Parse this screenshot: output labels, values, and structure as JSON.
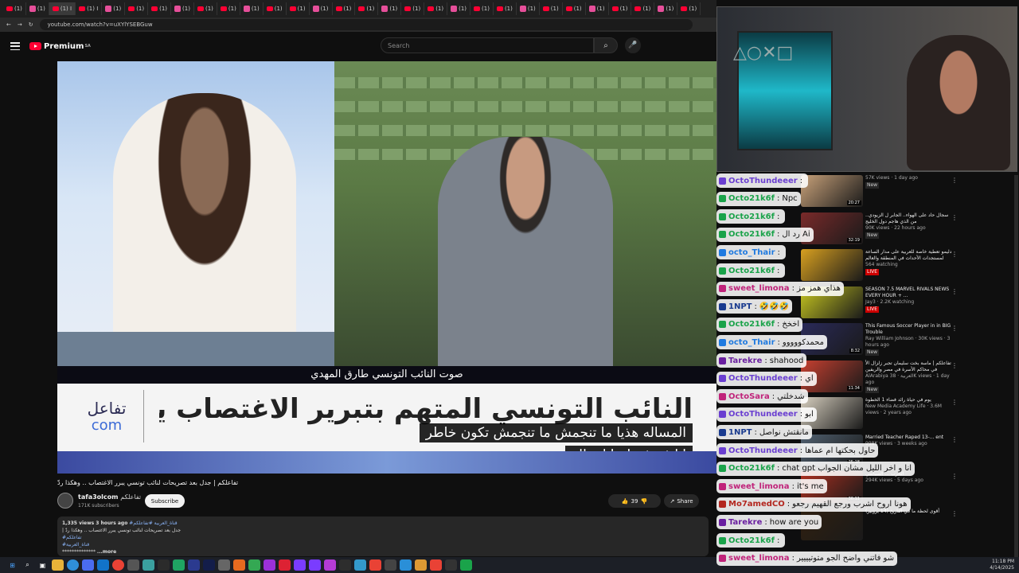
{
  "browser": {
    "tabs": [
      "(1)",
      "(1)",
      "(1) I",
      "(1) I",
      "(1)",
      "(1)",
      "(1)",
      "(1)",
      "(1)",
      "(1)",
      "(1)",
      "(1)",
      "(1)",
      "(1)",
      "(1)",
      "(1)",
      "(1)",
      "(1)",
      "(1)",
      "(1)",
      "(1)",
      "(1)",
      "(1)",
      "(1)",
      "(1)",
      "(1)",
      "(1)",
      "(1)",
      "(1)",
      "(1)"
    ],
    "url": "youtube.com/watch?v=uXYlYSEBGuw"
  },
  "yt": {
    "logo": "Premium",
    "region": "SA",
    "search_placeholder": "Search"
  },
  "video": {
    "caption_strip": "صوت النائب التونسي طارق المهدي",
    "brand_ar": "تفاعل",
    "brand_com": "com",
    "headline": "النائب التونسي المتهم بتبرير الاغتصاب يرد في تفاعلكم",
    "sub1": "المساله هذيا ما تنجمش ما تنجمش تكون خاطر",
    "sub2": "انا فم فم احيانا هناك",
    "title": "تفاعلكم | جدل بعد تصريحات لنائب تونسي يبرر الاغتصاب .. وهكذا ردّ",
    "channel_name": "tafa3olcom",
    "channel_ar": "تفاعلكم",
    "subscribers": "171K subscribers",
    "subscribe_label": "Subscribe",
    "likes": "39",
    "share_label": "Share",
    "desc_stats": "1,335 views  3 hours ago",
    "desc_tags": "#قناة_العربية #تفاعلكم",
    "desc_line2": "| جدل بعد تصريحات لنائب تونسي يبرر الاغتصاب .. وهكذا ردّ",
    "desc_line3": "#تفاعلكم",
    "desc_line4": "#قناة_العربية",
    "desc_more": "...more",
    "desc_dots": "**************"
  },
  "chat": [
    {
      "user": "OctoThundeeer",
      "msg": "",
      "color": "#6a3fd1"
    },
    {
      "user": "Octo21k6f",
      "msg": "Npc",
      "color": "#1aa34a"
    },
    {
      "user": "Octo21k6f",
      "msg": "",
      "color": "#1aa34a"
    },
    {
      "user": "Octo21k6f",
      "msg": "رد ال Ai",
      "color": "#1aa34a"
    },
    {
      "user": "octo_Thair",
      "msg": "",
      "color": "#1f7ae0"
    },
    {
      "user": "Octo21k6f",
      "msg": "",
      "color": "#1aa34a"
    },
    {
      "user": "sweet_limona",
      "msg": "هذاي همز مز",
      "color": "#c0237a"
    },
    {
      "user": "1NPT",
      "msg": "🤣🤣🤣",
      "color": "#1a3b8f"
    },
    {
      "user": "Octo21k6f",
      "msg": "اخخخ",
      "color": "#1aa34a"
    },
    {
      "user": "octo_Thair",
      "msg": "محمدكووووو",
      "color": "#1f7ae0"
    },
    {
      "user": "Tarekre",
      "msg": "shahood",
      "color": "#6a1fa0"
    },
    {
      "user": "OctoThundeeer",
      "msg": "اي",
      "color": "#6a3fd1"
    },
    {
      "user": "OctoSara",
      "msg": "شدخلتي",
      "color": "#c0237a"
    },
    {
      "user": "OctoThundeeer",
      "msg": "ابو",
      "color": "#6a3fd1"
    },
    {
      "user": "1NPT",
      "msg": "مانقتش نواصل",
      "color": "#1a3b8f"
    },
    {
      "user": "OctoThundeeer",
      "msg": "حاول بحكتها ام عماها",
      "color": "#6a3fd1"
    },
    {
      "user": "Octo21k6f",
      "msg": "chat gpt انا و اخر الليل مشان الجواب",
      "color": "#1aa34a"
    },
    {
      "user": "sweet_limona",
      "msg": "it's me",
      "color": "#c0237a"
    },
    {
      "user": "Mo7amedCO",
      "msg": "هونا اروح اشرب ورجع القهيم رجعو",
      "color": "#b3261e"
    },
    {
      "user": "Tarekre",
      "msg": "how are you",
      "color": "#6a1fa0"
    },
    {
      "user": "Octo21k6f",
      "msg": "",
      "color": "#1aa34a"
    },
    {
      "user": "sweet_limona",
      "msg": "شو فاتني واضح الجو متوتيييير",
      "color": "#c0237a"
    }
  ],
  "recs": [
    {
      "title": "",
      "meta": "57K views · 1 day ago",
      "badge": "New",
      "dur": "20:27"
    },
    {
      "title": "سجال حاد على الهواء.. الجابر ل الزيودي.. من الذي هاجم دول الخليج",
      "meta": "90K views · 22 hours ago",
      "badge": "New",
      "dur": "32:19"
    },
    {
      "title": "دليمو تعطية خاصة للعربية على مدار الساعة لمستجدات الأحداث في المنطقة والعالم",
      "meta": "564 watching",
      "badge": "LIVE",
      "dur": ""
    },
    {
      "title": "SEASON 7.5 MARVEL RIVALS NEWS EVERY HOUR + ...",
      "meta": "Jay3 · 2.2K watching",
      "badge": "LIVE",
      "dur": ""
    },
    {
      "title": "This Famous Soccer Player in in BIG Trouble",
      "meta": "Ray William Johnson · 30K views · 3 hours ago",
      "badge": "New",
      "dur": "8:32"
    },
    {
      "title": "تفاعلكم | ماسة بخت سليمان تجبر زلزال الأ في محاكم الأسرة في مصر والريفين",
      "meta": "AlArabiya العربية · 38K views · 1 day ago",
      "badge": "New",
      "dur": "11:34"
    },
    {
      "title": "يوم في حياة رائد فضاء 1 الخطوة",
      "meta": "New Media Academy Life · 3.6M views · 2 years ago",
      "badge": "",
      "dur": ""
    },
    {
      "title": "Married Teacher Raped 13-... ent",
      "meta": "998K views · 3 weeks ago",
      "badge": "",
      "dur": "25:18"
    },
    {
      "title": "الحرب ... السياسي",
      "meta": "294K views · 5 days ago",
      "badge": "",
      "dur": "36:11"
    },
    {
      "title": "أقوى لحظة ما في التاريخ (14 يروبير)",
      "meta": "",
      "badge": "",
      "dur": ""
    }
  ],
  "clock": {
    "time": "11:18 PM",
    "date": "4/14/2025"
  }
}
